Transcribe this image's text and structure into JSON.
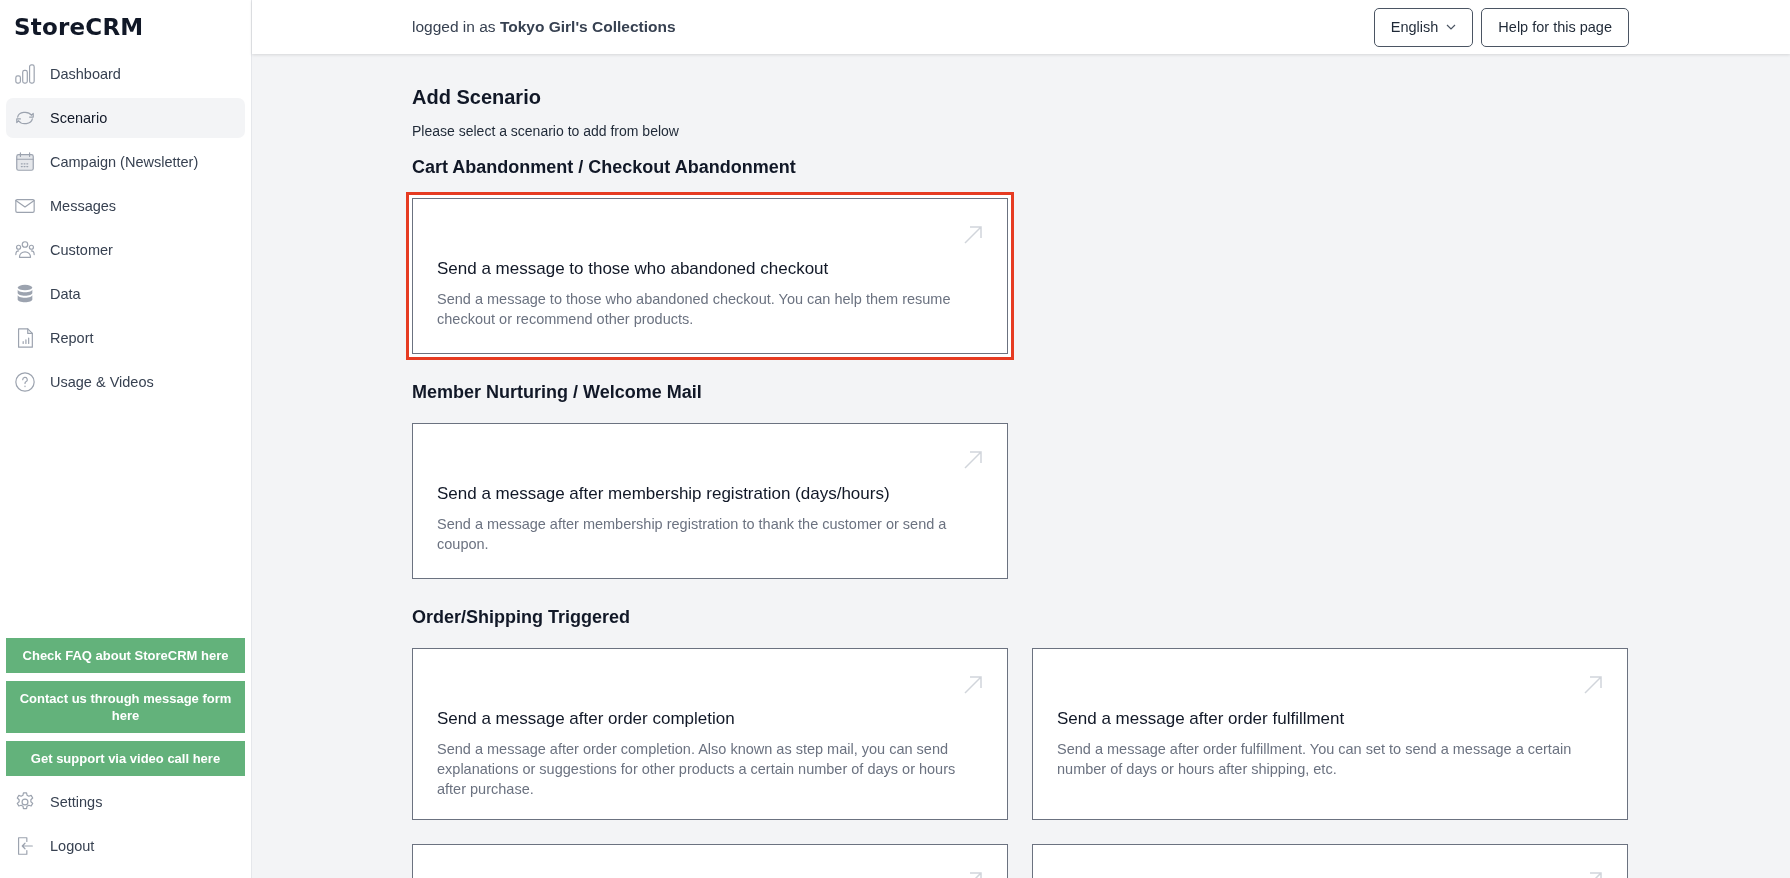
{
  "sidebar": {
    "logo": "StoreCRM",
    "nav": [
      {
        "label": "Dashboard",
        "kind": "chart",
        "selected": false
      },
      {
        "label": "Scenario",
        "kind": "sync",
        "selected": true
      },
      {
        "label": "Campaign (Newsletter)",
        "kind": "calendar",
        "selected": false
      },
      {
        "label": "Messages",
        "kind": "mail",
        "selected": false
      },
      {
        "label": "Customer",
        "kind": "people",
        "selected": false
      },
      {
        "label": "Data",
        "kind": "database",
        "selected": false
      },
      {
        "label": "Report",
        "kind": "report",
        "selected": false
      },
      {
        "label": "Usage & Videos",
        "kind": "help",
        "selected": false
      }
    ],
    "support_buttons": [
      "Check FAQ about StoreCRM here",
      "Contact us through message form here",
      "Get support via video call here"
    ],
    "bottom_nav": [
      {
        "label": "Settings",
        "kind": "gear"
      },
      {
        "label": "Logout",
        "kind": "logout"
      }
    ]
  },
  "header": {
    "login_text": "logged in as **Tokyo Girl's Collections**",
    "language": "English",
    "help_button": "Help for this page"
  },
  "page": {
    "title": "Add Scenario",
    "subtitle": "Please select a scenario to add from below",
    "sections": [
      {
        "heading": "Cart Abandonment / Checkout Abandonment",
        "cards": [
          {
            "kind": "full",
            "highlighted": true,
            "title": "Send a message to those who abandoned checkout",
            "description": "Send a message to those who abandoned checkout. You can help them resume checkout or recommend other products."
          }
        ]
      },
      {
        "heading": "Member Nurturing / Welcome Mail",
        "cards": [
          {
            "kind": "full",
            "highlighted": false,
            "title": "Send a message after membership registration (days/hours)",
            "description": "Send a message after membership registration to thank the customer or send a coupon."
          }
        ]
      },
      {
        "heading": "Order/Shipping Triggered",
        "cards": [
          {
            "kind": "full",
            "highlighted": false,
            "title": "Send a message after order completion",
            "description": "Send a message after order completion. Also known as step mail, you can send explanations or suggestions for other products a certain number of days or hours after purchase."
          },
          {
            "kind": "full",
            "highlighted": false,
            "title": "Send a message after order fulfillment",
            "description": "Send a message after order fulfillment. You can set to send a message a certain number of days or hours after shipping, etc."
          },
          {
            "kind": "cut-off",
            "highlighted": false
          },
          {
            "kind": "cut-off",
            "highlighted": false
          }
        ]
      }
    ]
  }
}
